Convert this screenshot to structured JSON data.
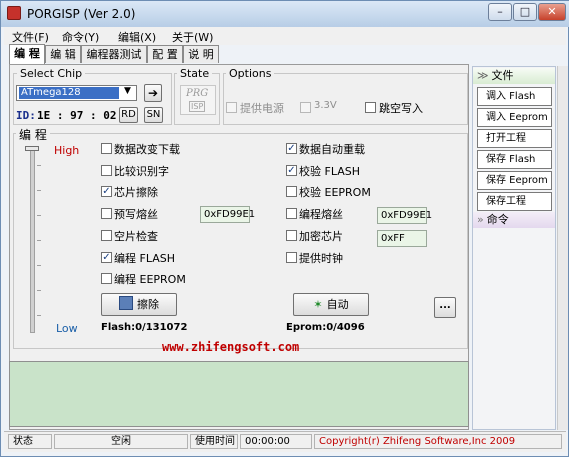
{
  "window": {
    "title": "PORGISP (Ver 2.0)",
    "min": "–",
    "max": "□",
    "close": "✕"
  },
  "menu": [
    "文件(F)",
    "命令(Y)",
    "编辑(X)",
    "关于(W)"
  ],
  "tabs": [
    "编 程",
    "编 辑",
    "编程器测试",
    "配 置",
    "说 明"
  ],
  "select_chip": {
    "label": "Select Chip",
    "value": "ATmega128",
    "id_label": "ID:",
    "id_value": "1E : 97 : 02",
    "rd": "RD",
    "sn": "SN"
  },
  "state": {
    "label": "State",
    "logo_top": "PRG",
    "logo_bottom": "ISP"
  },
  "options": {
    "label": "Options",
    "power": "提供电源",
    "voltage": "3.3V",
    "skip_blank": "跳空写入"
  },
  "program": {
    "label": "编 程",
    "high": "High",
    "low": "Low",
    "left_checks": [
      {
        "label": "数据改变下载",
        "checked": false
      },
      {
        "label": "比较识别字",
        "checked": false
      },
      {
        "label": "芯片擦除",
        "checked": true
      },
      {
        "label": "预写熔丝",
        "checked": false
      },
      {
        "label": "空片检查",
        "checked": false
      },
      {
        "label": "编程 FLASH",
        "checked": true
      },
      {
        "label": "编程 EEPROM",
        "checked": false
      }
    ],
    "right_checks": [
      {
        "label": "数据自动重载",
        "checked": true
      },
      {
        "label": "校验 FLASH",
        "checked": true
      },
      {
        "label": "校验 EEPROM",
        "checked": false
      },
      {
        "label": "编程熔丝",
        "checked": false
      },
      {
        "label": "加密芯片",
        "checked": false
      },
      {
        "label": "提供时钟",
        "checked": false
      }
    ],
    "prefuse_value": "0xFD99E1",
    "fuse_value": "0xFD99E1",
    "lock_value": "0xFF",
    "erase_btn": "擦除",
    "auto_btn": "自动",
    "more_btn": "...",
    "flash_stat": "Flash:0/131072",
    "eprom_stat": "Eprom:0/4096"
  },
  "website": "www.zhifengsoft.com",
  "right_panel": {
    "file_header": "文件",
    "buttons": [
      "调入 Flash",
      "调入 Eeprom",
      "打开工程",
      "保存 Flash",
      "保存 Eeprom",
      "保存工程"
    ],
    "cmd_header": "命令"
  },
  "status": {
    "state_label": "状态",
    "state_value": "空闲",
    "time_label": "使用时间",
    "time_value": "00:00:00",
    "copyright": "Copyright(r) Zhifeng Software,Inc 2009"
  },
  "colors": {
    "accent": "#c00000",
    "log_bg": "#c9e3c9",
    "select_hl": "#3b6fc5"
  }
}
